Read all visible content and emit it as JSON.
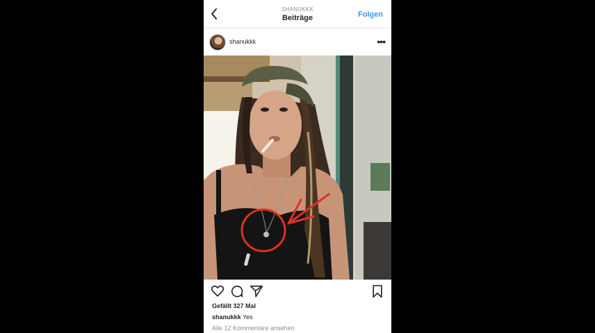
{
  "header": {
    "username": "SHANUKKK",
    "title": "Beiträge",
    "follow_label": "Folgen"
  },
  "post": {
    "username": "shanukkk",
    "likes": "Gefällt 327 Mal",
    "caption_user": "shanukkk",
    "caption_text": "Yes",
    "view_comments": "Alle 12 Kommentare ansehen"
  },
  "icons": {
    "back": "chevron-left-icon",
    "more": "more-dots-icon",
    "like": "heart-icon",
    "comment": "comment-icon",
    "share": "send-icon",
    "save": "bookmark-icon"
  },
  "colors": {
    "accent": "#3897f0",
    "annotation": "#e03020"
  }
}
